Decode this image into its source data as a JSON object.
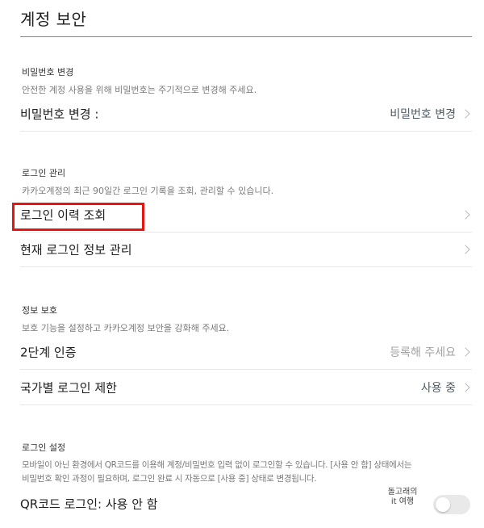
{
  "page": {
    "title": "계정 보안"
  },
  "password_section": {
    "title": "비밀번호 변경",
    "description": "안전한 계정 사용을 위해 비밀번호는 주기적으로 변경해 주세요.",
    "row": {
      "label": "비밀번호 변경 :",
      "action": "비밀번호 변경"
    }
  },
  "login_management": {
    "title": "로그인 관리",
    "description": "카카오계정의 최근 90일간 로그인 기록을 조회, 관리할 수 있습니다.",
    "rows": [
      {
        "label": "로그인 이력 조회"
      },
      {
        "label": "현재 로그인 정보 관리"
      }
    ],
    "highlight_color": "#e8140f"
  },
  "info_protection": {
    "title": "정보 보호",
    "description": "보호 기능을 설정하고 카카오계정 보안을 강화해 주세요.",
    "rows": [
      {
        "label": "2단계 인증",
        "value": "등록해 주세요"
      },
      {
        "label": "국가별 로그인 제한",
        "value": "사용 중"
      }
    ]
  },
  "login_settings": {
    "title": "로그인 설정",
    "description_line1": "모바일이 아닌 환경에서 QR코드를 이용해 계정/비밀번호 입력 없이 로그인할 수 있습니다. [사용 안 함] 상태에서는",
    "description_line2": "비밀번호 확인 과정이 필요하며, 로그인 완료 시 자동으로 [사용 중] 상태로 변경됩니다.",
    "row": {
      "label": "QR코드 로그인: 사용 안 함",
      "toggle_on": false
    }
  },
  "watermark": {
    "line1": "돌고래의",
    "line2": "it 여행"
  }
}
